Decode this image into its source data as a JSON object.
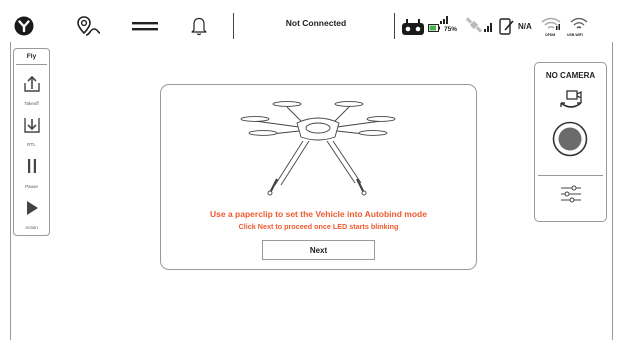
{
  "toolbar": {
    "connection_status": "Not Connected",
    "battery_percent": "75%",
    "signal_label": "N/A",
    "wifi_labels": [
      "OFDM",
      "USB WIFI"
    ]
  },
  "fly_panel": {
    "title": "Fly",
    "buttons": [
      {
        "label": "Takeoff",
        "icon": "takeoff-icon"
      },
      {
        "label": "RTL",
        "icon": "rtl-icon"
      },
      {
        "label": "Pause",
        "icon": "pause-icon"
      },
      {
        "label": "Action",
        "icon": "play-icon"
      }
    ]
  },
  "camera_panel": {
    "title": "NO CAMERA"
  },
  "dialog": {
    "message_primary": "Use a paperclip to set the Vehicle into Autobind mode",
    "message_secondary": "Click Next to proceed once LED starts blinking",
    "next_label": "Next"
  },
  "colors": {
    "accent_message": "#ef5a30",
    "battery_fill": "#4caf50",
    "record_button": "#6b6b6b"
  }
}
